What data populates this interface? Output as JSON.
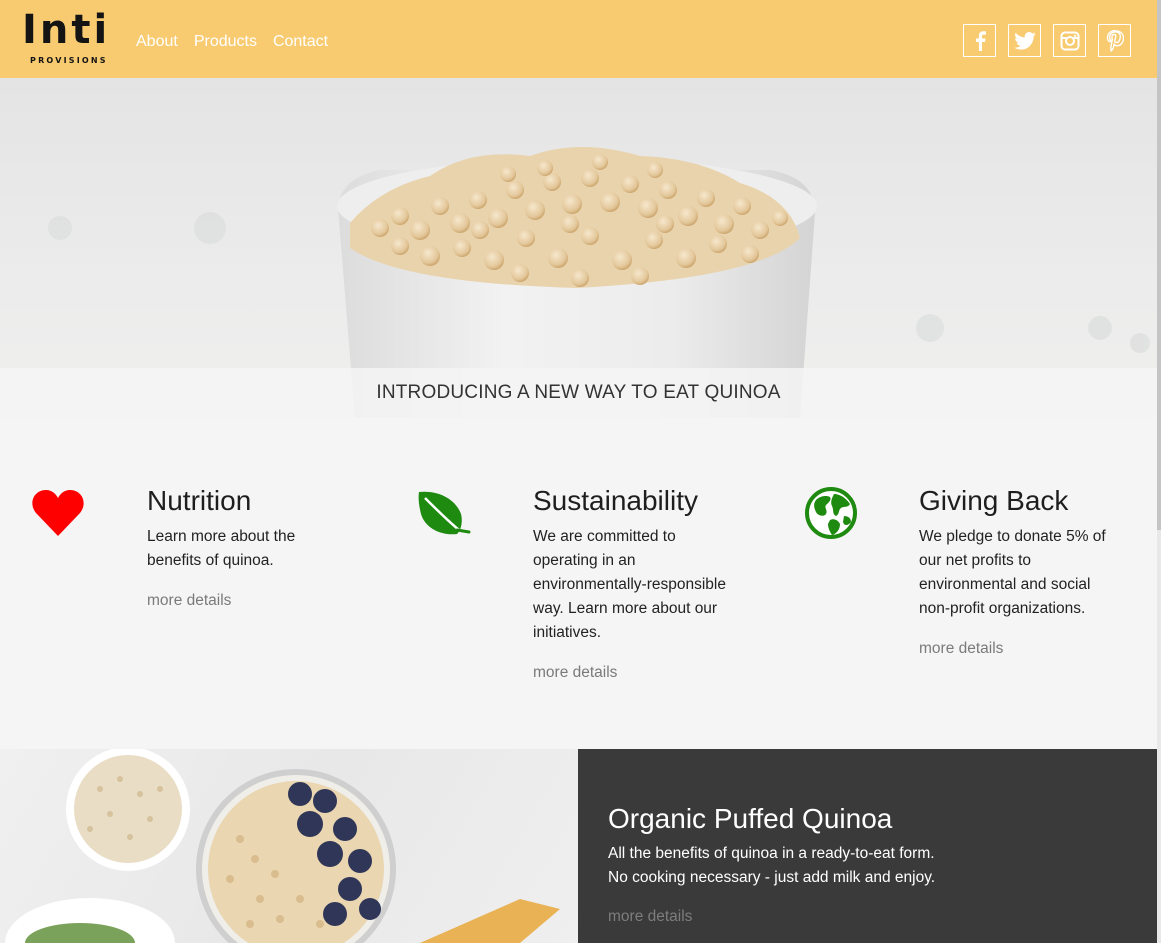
{
  "header": {
    "logo_word": "Inti",
    "logo_sub": "PROVISIONS",
    "nav": [
      {
        "label": "About"
      },
      {
        "label": "Products"
      },
      {
        "label": "Contact"
      }
    ],
    "social": [
      {
        "icon": "facebook-icon"
      },
      {
        "icon": "twitter-icon"
      },
      {
        "icon": "instagram-icon"
      },
      {
        "icon": "pinterest-icon"
      }
    ]
  },
  "hero": {
    "title": "INTRODUCING A NEW WAY TO EAT QUINOA"
  },
  "features": [
    {
      "icon": "heart-icon",
      "icon_color": "#ff0000",
      "title": "Nutrition",
      "text": [
        "Learn more about the",
        "benefits of quinoa."
      ],
      "link": "more details"
    },
    {
      "icon": "leaf-icon",
      "icon_color": "#1e8a10",
      "title": "Sustainability",
      "text": [
        "We are committed to",
        "operating in an",
        "environmentally-responsible",
        "way. Learn more about our",
        "initiatives."
      ],
      "link": "more details"
    },
    {
      "icon": "globe-icon",
      "icon_color": "#1e8a10",
      "title": "Giving Back",
      "text": [
        "We pledge to donate 5% of",
        "our net profits to",
        "environmental and social",
        "non-profit organizations."
      ],
      "link": "more details"
    }
  ],
  "product": {
    "title": "Organic Puffed Quinoa",
    "text": [
      "All the benefits of quinoa in a ready-to-eat form.",
      "No cooking necessary - just add milk and enjoy."
    ],
    "link": "more details"
  },
  "colors": {
    "header_bg": "#f8cb70",
    "dark_panel": "#3a3a3a",
    "accent_red": "#ff0000",
    "accent_green": "#1e8a10"
  }
}
